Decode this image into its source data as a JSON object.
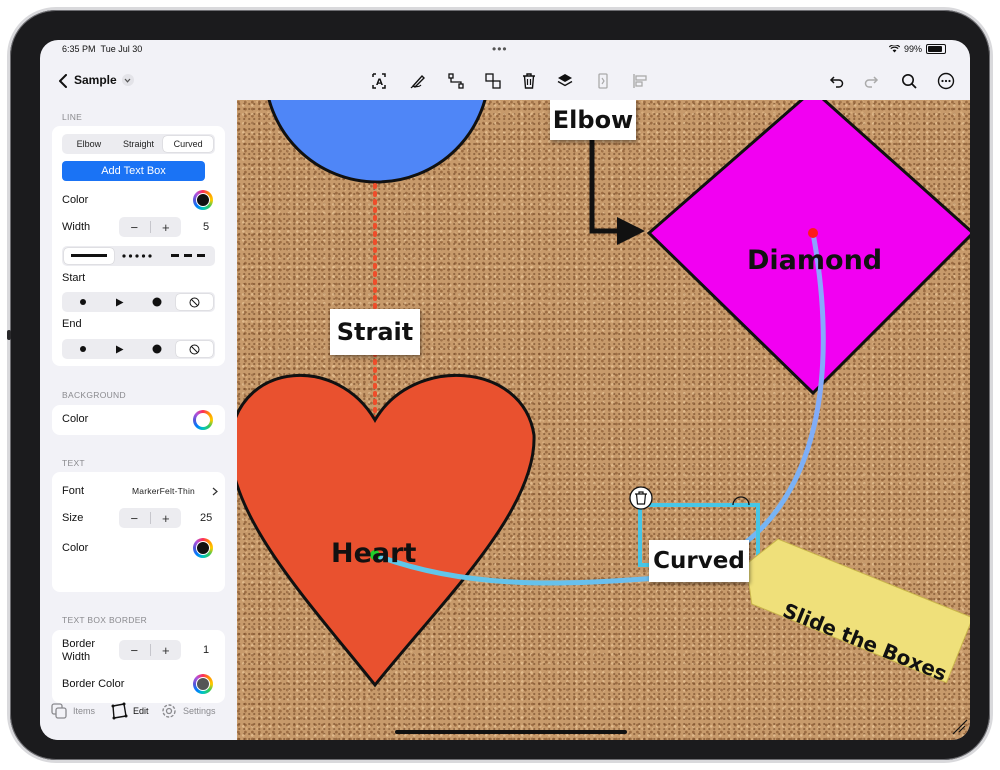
{
  "status": {
    "time": "6:35 PM",
    "date": "Tue Jul 30",
    "battery": "99%"
  },
  "toolbar": {
    "title": "Sample",
    "icons": [
      "select-icon",
      "pen-icon",
      "connector-icon",
      "group-icon",
      "trash-icon",
      "layers-icon",
      "flip-icon",
      "align-icon"
    ],
    "right_icons": [
      "undo-icon",
      "redo-icon",
      "search-icon",
      "more-icon"
    ]
  },
  "sidebar": {
    "line": {
      "header": "LINE",
      "segments": [
        "Elbow",
        "Straight",
        "Curved"
      ],
      "selected": "Curved",
      "add_text_box": "Add Text Box",
      "color_label": "Color",
      "color": "#111111",
      "width_label": "Width",
      "width_value": "5",
      "start_label": "Start",
      "end_label": "End",
      "minus": "−",
      "plus": "+"
    },
    "background": {
      "header": "BACKGROUND",
      "color_label": "Color",
      "color": "#ffffff"
    },
    "text": {
      "header": "TEXT",
      "font_label": "Font",
      "font_value": "MarkerFelt-Thin",
      "size_label": "Size",
      "size_value": "25",
      "color_label": "Color",
      "color": "#111111"
    },
    "border": {
      "header": "TEXT BOX BORDER",
      "width_label_1": "Border",
      "width_label_2": "Width",
      "width_value": "1",
      "color_label": "Border Color",
      "color": "#555555"
    },
    "tabs": {
      "items": "Items",
      "edit": "Edit",
      "settings": "Settings"
    }
  },
  "canvas": {
    "labels": {
      "elbow": "Elbow",
      "strait": "Strait",
      "diamond": "Diamond",
      "heart": "Heart",
      "curved": "Curved",
      "slide": "Slide the Boxes"
    },
    "colors": {
      "circle": "#4f86f7",
      "heart": "#e9512f",
      "diamond": "#f200f2",
      "dotted_line": "#ef4d2a",
      "curve_start": "#5cc9e8",
      "curve_end": "#8fa2ff",
      "selection": "#47c6e6",
      "note": "#efe07a"
    }
  }
}
